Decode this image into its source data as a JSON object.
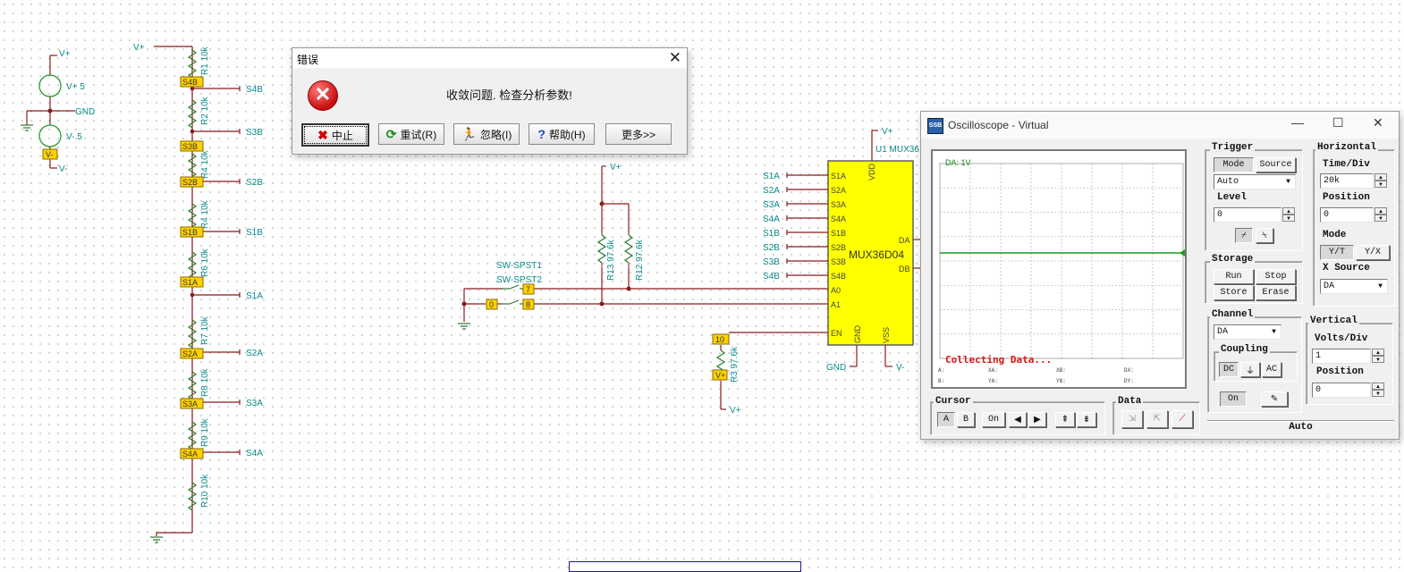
{
  "colors": {
    "wire": "#8b1a1a",
    "label": "#0a8a8a",
    "part": "#2a7a2a",
    "tag": "#ffd200",
    "chip": "#ffff00",
    "trace": "#1f9a1f",
    "error": "#e01010"
  },
  "schematic": {
    "power_labels": {
      "vplus_top": "V+",
      "vplus_src": "V+ 5",
      "gnd": "GND",
      "vminus_src": "V- 5",
      "vminus_tag": "V-",
      "vminus": "V-"
    },
    "ladder": {
      "vplus": "V+",
      "resistors": [
        "R1 10k",
        "R2 10k",
        "R4 10k",
        "R4 10k",
        "R6 10k",
        "R7 10k",
        "R8 10k",
        "R9 10k",
        "R10 10k"
      ],
      "taps": [
        "S4B",
        "S3B",
        "S2B",
        "S1B",
        "S1A",
        "S2A",
        "S3A",
        "S4A"
      ],
      "tap_tags": [
        "S4B",
        "S3B",
        "S2B",
        "S1B",
        "S1A",
        "",
        "S2A",
        "S3A",
        "S4A"
      ]
    },
    "switches": {
      "sw1": "SW-SPST1",
      "sw2": "SW-SPST2",
      "tag_a": "7",
      "tag_b": "8",
      "tag_zero": "0"
    },
    "pullups": {
      "vplus": "V+",
      "r13": "R13 97.6k",
      "r12": "R12 97.6k"
    },
    "enable": {
      "tag": "10",
      "vtag": "V+",
      "r3": "R3 97.6k",
      "vplus": "V+"
    },
    "mux": {
      "name": "MUX36D04",
      "ref": "U1 MUX36",
      "vplus": "V+",
      "gnd": "GND",
      "vminus": "V-",
      "left_pins": [
        "S1A",
        "S2A",
        "S3A",
        "S4A",
        "S1B",
        "S2B",
        "S3B",
        "S4B",
        "A0",
        "A1"
      ],
      "net_labels": [
        "S1A",
        "S2A",
        "S3A",
        "S4A",
        "S1B",
        "S2B",
        "S3B",
        "S4B"
      ],
      "en": "EN",
      "vdd": "VDD",
      "gnd_pin": "GND",
      "vss_pin": "VSS",
      "da": "DA",
      "db": "DB"
    }
  },
  "error_dialog": {
    "title": "错误",
    "message": "收敛问题. 检查分析参数!",
    "close_label": "✕",
    "buttons": [
      {
        "icon": "✖",
        "label": "中止"
      },
      {
        "icon": "⟳",
        "label": "重试(R)"
      },
      {
        "icon": "🏃",
        "label": "忽略(I)"
      },
      {
        "icon": "?",
        "label": "帮助(H)"
      },
      {
        "icon": "",
        "label": "更多>>"
      }
    ]
  },
  "oscilloscope": {
    "title": "Oscilloscope - Virtual",
    "logo": "SSB",
    "win_controls": {
      "min": "—",
      "max": "☐",
      "close": "✕"
    },
    "screen": {
      "channel_label": "DA: 1V",
      "status": "Collecting Data...",
      "meas_row1": [
        "A:",
        "XA:",
        "XB:",
        "DX:"
      ],
      "meas_row2": [
        "B:",
        "YA:",
        "YB:",
        "DY:"
      ]
    },
    "trigger": {
      "label": "Trigger",
      "mode": "Mode",
      "source": "Source",
      "select": "Auto",
      "level_label": "Level",
      "level": "0"
    },
    "horizontal": {
      "label": "Horizontal",
      "timediv_label": "Time/Div",
      "timediv": "20k",
      "position_label": "Position",
      "position": "0",
      "mode_label": "Mode",
      "yt": "Y/T",
      "yx": "Y/X",
      "xsource_label": "X Source",
      "xsource": "DA"
    },
    "storage": {
      "label": "Storage",
      "run": "Run",
      "stop": "Stop",
      "store": "Store",
      "erase": "Erase"
    },
    "channel": {
      "label": "Channel",
      "select": "DA",
      "coupling_label": "Coupling",
      "dc": "DC",
      "ac": "AC",
      "on": "On"
    },
    "vertical": {
      "label": "Vertical",
      "voltsdiv_label": "Volts/Div",
      "voltsdiv": "1",
      "position_label": "Position",
      "position": "0"
    },
    "cursor": {
      "label": "Cursor",
      "a": "A",
      "b": "B",
      "on": "On"
    },
    "data": {
      "label": "Data"
    },
    "auto": "Auto"
  }
}
